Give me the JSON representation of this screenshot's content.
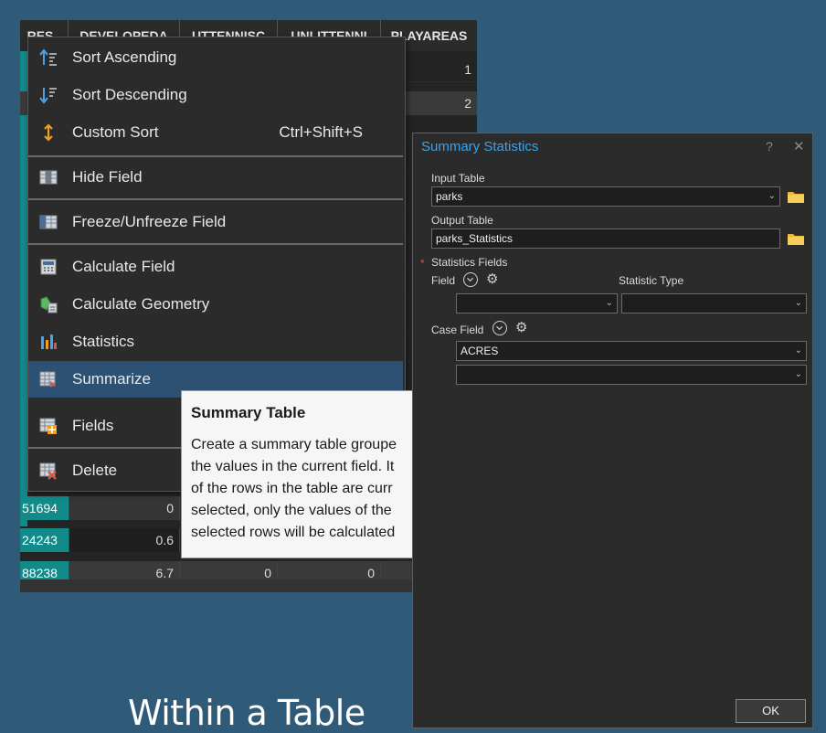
{
  "table": {
    "headers": [
      "RES",
      "DEVELOPEDA",
      "UTTENNISC",
      "UNLITTENNI",
      "PLAYAREAS"
    ],
    "rows": [
      {
        "id": "",
        "c1": "",
        "c2": "",
        "c3": "",
        "c4": "1"
      },
      {
        "id": "",
        "c1": "",
        "c2": "",
        "c3": "",
        "c4": "2"
      },
      {
        "id": "51694",
        "c1": "0",
        "c2": "",
        "c3": "",
        "c4": ""
      },
      {
        "id": "24243",
        "c1": "0.6",
        "c2": "",
        "c3": "",
        "c4": ""
      },
      {
        "id": "88238",
        "c1": "6.7",
        "c2": "0",
        "c3": "0",
        "c4": ""
      }
    ]
  },
  "menu": {
    "items": [
      {
        "label": "Sort Ascending",
        "shortcut": "",
        "icon": "sort-ascending-icon"
      },
      {
        "label": "Sort Descending",
        "shortcut": "",
        "icon": "sort-descending-icon"
      },
      {
        "label": "Custom Sort",
        "shortcut": "Ctrl+Shift+S",
        "icon": "custom-sort-icon"
      },
      {
        "label": "Hide Field",
        "shortcut": "",
        "icon": "hide-field-icon"
      },
      {
        "label": "Freeze/Unfreeze Field",
        "shortcut": "",
        "icon": "freeze-field-icon"
      },
      {
        "label": "Calculate Field",
        "shortcut": "",
        "icon": "calculate-field-icon"
      },
      {
        "label": "Calculate Geometry",
        "shortcut": "",
        "icon": "calculate-geometry-icon"
      },
      {
        "label": "Statistics",
        "shortcut": "",
        "icon": "statistics-icon"
      },
      {
        "label": "Summarize",
        "shortcut": "",
        "icon": "summarize-icon",
        "highlighted": true
      },
      {
        "label": "Fields",
        "shortcut": "",
        "icon": "fields-icon"
      },
      {
        "label": "Delete",
        "shortcut": "",
        "icon": "delete-field-icon"
      }
    ]
  },
  "tooltip": {
    "title": "Summary Table",
    "lines": [
      "Create a summary table groupe",
      "the values in the current field. It",
      "of the rows in the table are curr",
      "selected, only the values of the",
      "selected rows will be calculated"
    ]
  },
  "dialog": {
    "title": "Summary Statistics",
    "help": "?",
    "close": "✕",
    "input_table_label": "Input Table",
    "input_table_value": "parks",
    "output_table_label": "Output Table",
    "output_table_value": "parks_Statistics",
    "required_marker": "*",
    "statistics_fields_label": "Statistics Fields",
    "field_label": "Field",
    "statistic_type_label": "Statistic Type",
    "field_value": "",
    "statistic_type_value": "",
    "case_field_label": "Case Field",
    "case_field_values": [
      "ACRES",
      ""
    ],
    "ok_label": "OK",
    "accent_color": "#3ba3ea"
  },
  "slide_title": "Within a Table"
}
